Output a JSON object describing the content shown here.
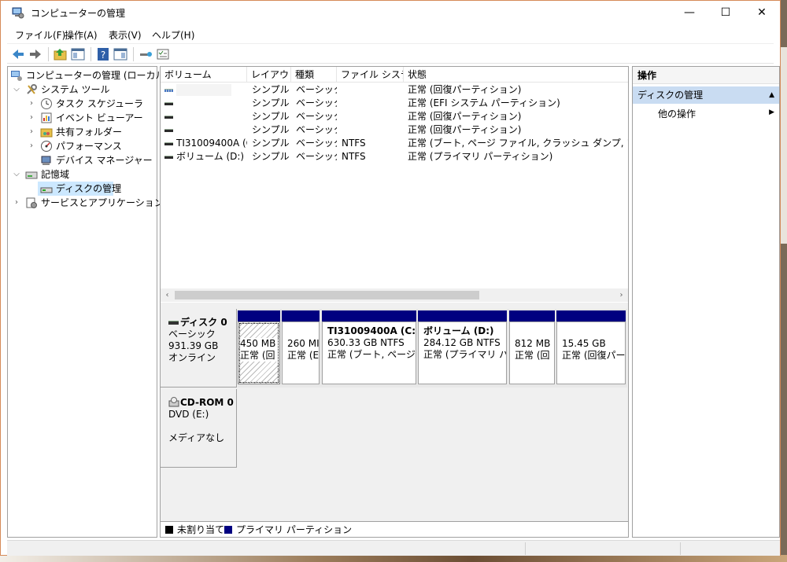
{
  "window": {
    "title": "コンピューターの管理"
  },
  "menubar": [
    "ファイル(F)",
    "操作(A)",
    "表示(V)",
    "ヘルプ(H)"
  ],
  "tree": [
    {
      "label": "コンピューターの管理 (ローカル)",
      "icon": "computer-management-icon"
    },
    {
      "label": "システム ツール",
      "icon": "tools-icon"
    },
    {
      "label": "タスク スケジューラ",
      "icon": "clock-icon"
    },
    {
      "label": "イベント ビューアー",
      "icon": "event-viewer-icon"
    },
    {
      "label": "共有フォルダー",
      "icon": "shared-folder-icon"
    },
    {
      "label": "パフォーマンス",
      "icon": "performance-icon"
    },
    {
      "label": "デバイス マネージャー",
      "icon": "device-manager-icon"
    },
    {
      "label": "記憶域",
      "icon": "storage-icon"
    },
    {
      "label": "ディスクの管理",
      "icon": "disk-management-icon"
    },
    {
      "label": "サービスとアプリケーション",
      "icon": "services-icon"
    }
  ],
  "volume_list": {
    "columns": [
      "ボリューム",
      "レイアウト",
      "種類",
      "ファイル システム",
      "状態"
    ],
    "rows": [
      {
        "volume": "",
        "layout": "シンプル",
        "type": "ベーシック",
        "fs": "",
        "status": "正常 (回復パーティション)"
      },
      {
        "volume": "",
        "layout": "シンプル",
        "type": "ベーシック",
        "fs": "",
        "status": "正常 (EFI システム パーティション)"
      },
      {
        "volume": "",
        "layout": "シンプル",
        "type": "ベーシック",
        "fs": "",
        "status": "正常 (回復パーティション)"
      },
      {
        "volume": "",
        "layout": "シンプル",
        "type": "ベーシック",
        "fs": "",
        "status": "正常 (回復パーティション)"
      },
      {
        "volume": "TI31009400A (C:)",
        "layout": "シンプル",
        "type": "ベーシック",
        "fs": "NTFS",
        "status": "正常 (ブート, ページ ファイル, クラッシュ ダンプ, プライマリ パーテ"
      },
      {
        "volume": "ボリューム (D:)",
        "layout": "シンプル",
        "type": "ベーシック",
        "fs": "NTFS",
        "status": "正常 (プライマリ パーティション)"
      }
    ]
  },
  "disks": [
    {
      "name": "ディスク 0",
      "kind": "ベーシック",
      "size": "931.39 GB",
      "state": "オンライン",
      "partitions": [
        {
          "name": "",
          "size": "450 MB",
          "status": "正常 (回"
        },
        {
          "name": "",
          "size": "260 MI",
          "status": "正常 (E"
        },
        {
          "name": "TI31009400A  (C:)",
          "size": "630.33 GB NTFS",
          "status": "正常 (ブート, ページ フ"
        },
        {
          "name": "ボリューム  (D:)",
          "size": "284.12 GB NTFS",
          "status": "正常 (プライマリ パー"
        },
        {
          "name": "",
          "size": "812 MB",
          "status": "正常 (回"
        },
        {
          "name": "",
          "size": "15.45 GB",
          "status": "正常 (回復パー"
        }
      ]
    },
    {
      "name": "CD-ROM 0",
      "kind": "DVD (E:)",
      "size": "",
      "state": "メディアなし"
    }
  ],
  "legend": [
    {
      "label": "未割り当て",
      "color": "#000000"
    },
    {
      "label": "プライマリ パーティション",
      "color": "#000080"
    }
  ],
  "actions": {
    "title": "操作",
    "section": "ディスクの管理",
    "item": "他の操作"
  },
  "colors": {
    "primary_partition": "#000080",
    "selection": "#cce8ff",
    "action_section": "#c9dcf2"
  }
}
